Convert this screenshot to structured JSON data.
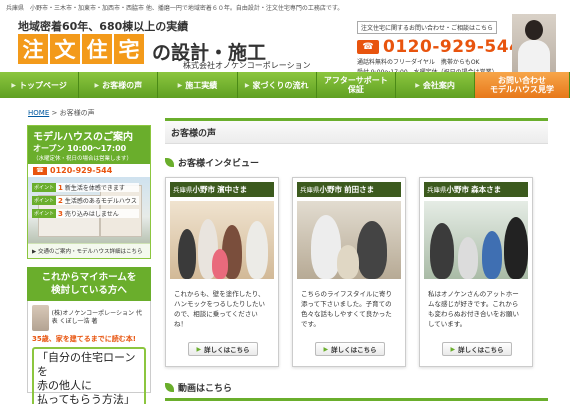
{
  "topbar": "兵庫県　小野市・三木市・加東市・加西市・西脇市 他、播磨一円で地域密着６０年。自由設計・注文住宅専門の工務店です。",
  "header": {
    "tagline": "地域密着60年、680棟以上の実績",
    "logo_chars": [
      "注",
      "文",
      "住",
      "宅"
    ],
    "logo_suffix": "の設計・施工",
    "company": "株式会社オノケンコーポレーション",
    "contact_note": "注文住宅に関するお問い合わせ・ご相談はこちら",
    "free_icon": "☎",
    "phone": "0120-929-544",
    "contact_line1": "通話料無料のフリーダイヤル　携帯からもOK",
    "contact_line2": "受付 9:00～17:00　水曜定休（祝日の場合は営業）"
  },
  "nav": [
    {
      "label": "トップページ"
    },
    {
      "label": "お客様の声"
    },
    {
      "label": "施工実績"
    },
    {
      "label": "家づくりの流れ"
    },
    {
      "label": "アフターサポート\n保証"
    },
    {
      "label": "会社案内"
    },
    {
      "label": "お問い合わせ\nモデルハウス見学"
    }
  ],
  "breadcrumb": {
    "home": "HOME",
    "sep": " > ",
    "current": "お客様の声"
  },
  "sidebar": {
    "model_title": "モデルハウスのご案内",
    "model_hours": "オープン 10:00～17:00",
    "model_note": "（水曜定休・祝日の場合は営業します）",
    "model_phone": "0120-929-544",
    "points": [
      {
        "tag": "ポイント",
        "num": "1",
        "text": "新生活を体感できます"
      },
      {
        "tag": "ポイント",
        "num": "2",
        "text": "生活感のあるモデルハウス"
      },
      {
        "tag": "ポイント",
        "num": "3",
        "text": "売り込みはしません"
      }
    ],
    "access": "▶ 交通のご案内・モデルハウス詳細はこちら",
    "home_title1": "これからマイホームを",
    "home_title2": "検討している方へ",
    "consult_name": "(株)オノケンコーポレーション 代表 くぼし一浩 著",
    "consult_age": "35歳、家を建てるまでに読む本!",
    "loan_line1": "「自分の住宅ローンを",
    "loan_line2": "赤の他人に",
    "loan_line3": "払ってもらう方法」"
  },
  "main": {
    "title": "お客様の声",
    "interview_title": "お客様インタビュー",
    "cards": [
      {
        "pref": "兵庫県",
        "city": "小野市",
        "name": "濱中さま",
        "text": "これからも、壁を塗作したり、ハンモックをつるしたりしたいので、相談に乗ってくださいね！",
        "button": "詳しくはこちら"
      },
      {
        "pref": "兵庫県",
        "city": "小野市",
        "name": "前田さま",
        "text": "こちらのライフスタイルに寄り添って下さいました。子育ての色々な話もしやすくて良かったです。",
        "button": "詳しくはこちら"
      },
      {
        "pref": "兵庫県",
        "city": "小野市",
        "name": "森本さま",
        "text": "私はオノケンさんのアットホームな感じが好きです。これからも変わらぬお付き合いをお願いしています。",
        "button": "詳しくはこちら"
      }
    ],
    "video_title": "動画はこちら"
  }
}
